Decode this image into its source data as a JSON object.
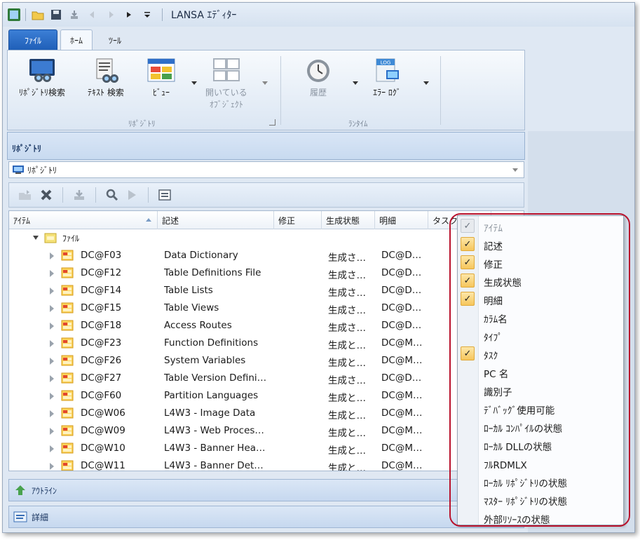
{
  "window": {
    "title": "LANSA ｴﾃﾞｨﾀｰ"
  },
  "tabs": [
    {
      "label": "ﾌｧｲﾙ"
    },
    {
      "label": "ﾎｰﾑ"
    },
    {
      "label": "ﾂｰﾙ"
    }
  ],
  "ribbon": {
    "repo_search": "ﾘﾎﾟｼﾞﾄﾘ検索",
    "text_search": "ﾃｷｽﾄ 検索",
    "view": "ﾋﾞｭｰ",
    "open_objects_line1": "開いている",
    "open_objects_line2": "ｵﾌﾞｼﾞｪｸﾄ",
    "history": "履歴",
    "error_log": "ｴﾗｰ ﾛｸﾞ",
    "group_repository": "ﾘﾎﾟｼﾞﾄﾘ",
    "group_runtime": "ﾗﾝﾀｲﾑ"
  },
  "panel": {
    "title": "ﾘﾎﾟｼﾞﾄﾘ",
    "combo_value": "ﾘﾎﾟｼﾞﾄﾘ"
  },
  "grid": {
    "headers": {
      "item": "ｱｲﾃﾑ",
      "desc": "記述",
      "mod": "修正",
      "gen": "生成状態",
      "detail": "明細",
      "task": "タスク"
    },
    "folder": "ﾌｧｲﾙ",
    "rows": [
      {
        "name": "DC@F03",
        "desc": "Data Dictionary",
        "gen": "生成さ…",
        "detail": "DC@D…"
      },
      {
        "name": "DC@F12",
        "desc": "Table Definitions File",
        "gen": "生成さ…",
        "detail": "DC@D…"
      },
      {
        "name": "DC@F14",
        "desc": "Table Lists",
        "gen": "生成さ…",
        "detail": "DC@D…"
      },
      {
        "name": "DC@F15",
        "desc": "Table Views",
        "gen": "生成さ…",
        "detail": "DC@D…"
      },
      {
        "name": "DC@F18",
        "desc": "Access Routes",
        "gen": "生成さ…",
        "detail": "DC@D…"
      },
      {
        "name": "DC@F23",
        "desc": "Function Definitions",
        "gen": "生成と…",
        "detail": "DC@M…"
      },
      {
        "name": "DC@F26",
        "desc": "System Variables",
        "gen": "生成と…",
        "detail": "DC@M…"
      },
      {
        "name": "DC@F27",
        "desc": "Table Version Defini…",
        "gen": "生成さ…",
        "detail": "DC@D…"
      },
      {
        "name": "DC@F60",
        "desc": "Partition Languages",
        "gen": "生成と…",
        "detail": "DC@M…"
      },
      {
        "name": "DC@W06",
        "desc": "L4W3 - Image Data",
        "gen": "生成と…",
        "detail": "DC@M…"
      },
      {
        "name": "DC@W09",
        "desc": "L4W3 - Web Proces…",
        "gen": "生成と…",
        "detail": "DC@M…"
      },
      {
        "name": "DC@W10",
        "desc": "L4W3 - Banner Hea…",
        "gen": "生成と…",
        "detail": "DC@M…"
      },
      {
        "name": "DC@W11",
        "desc": "L4W3 - Banner Det…",
        "gen": "生成と…",
        "detail": "DC@M…"
      }
    ]
  },
  "bottom": {
    "outline": "ｱｳﾄﾗｲﾝ",
    "details": "詳細"
  },
  "column_menu": {
    "items": [
      {
        "label": "ｱｲﾃﾑ",
        "checked": true,
        "disabled": true
      },
      {
        "label": "記述",
        "checked": true,
        "disabled": false
      },
      {
        "label": "修正",
        "checked": true,
        "disabled": false
      },
      {
        "label": "生成状態",
        "checked": true,
        "disabled": false
      },
      {
        "label": "明細",
        "checked": true,
        "disabled": false
      },
      {
        "label": "ｶﾗﾑ名",
        "checked": false,
        "disabled": false
      },
      {
        "label": "ﾀｲﾌﾟ",
        "checked": false,
        "disabled": false
      },
      {
        "label": "ﾀｽｸ",
        "checked": true,
        "disabled": false
      },
      {
        "label": "PC 名",
        "checked": false,
        "disabled": false
      },
      {
        "label": "識別子",
        "checked": false,
        "disabled": false
      },
      {
        "label": "ﾃﾞﾊﾞｯｸﾞ使用可能",
        "checked": false,
        "disabled": false
      },
      {
        "label": "ﾛｰｶﾙ ｺﾝﾊﾟｲﾙの状態",
        "checked": false,
        "disabled": false
      },
      {
        "label": "ﾛｰｶﾙ DLLの状態",
        "checked": false,
        "disabled": false
      },
      {
        "label": "ﾌﾙRDMLX",
        "checked": false,
        "disabled": false
      },
      {
        "label": "ﾛｰｶﾙ ﾘﾎﾟｼﾞﾄﾘの状態",
        "checked": false,
        "disabled": false
      },
      {
        "label": "ﾏｽﾀｰ ﾘﾎﾟｼﾞﾄﾘの状態",
        "checked": false,
        "disabled": false
      },
      {
        "label": "外部ﾘｿｰｽの状態",
        "checked": false,
        "disabled": false
      }
    ]
  },
  "colors": {
    "accent": "#1f5fb8",
    "highlight": "#b9122c",
    "check_fill": "#f6c65c"
  }
}
